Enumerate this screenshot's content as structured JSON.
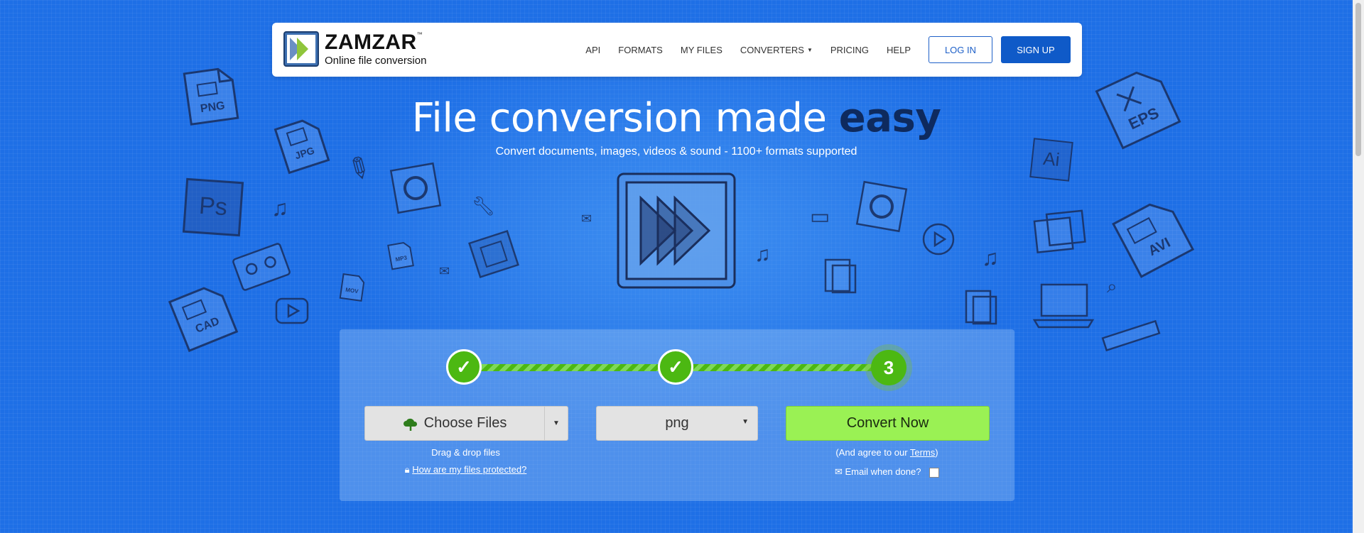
{
  "logo": {
    "name": "ZAMZAR",
    "trademark": "™",
    "tagline": "Online file conversion"
  },
  "nav": {
    "links": [
      "API",
      "FORMATS",
      "MY FILES",
      "CONVERTERS",
      "PRICING",
      "HELP"
    ],
    "login_label": "LOG IN",
    "signup_label": "SIGN UP"
  },
  "hero": {
    "title_start": "File conversion made ",
    "title_emphasis": "easy",
    "subtitle": "Convert documents, images, videos & sound - 1100+ formats supported"
  },
  "doodle_labels": {
    "png": "PNG",
    "jpg": "JPG",
    "ps": "Ps",
    "cad": "CAD",
    "eps": "EPS",
    "ai": "Ai",
    "avi": "AVI",
    "mp3": "MP3",
    "mov": "MOV"
  },
  "converter": {
    "steps": [
      {
        "label": "✓",
        "state": "complete"
      },
      {
        "label": "✓",
        "state": "complete"
      },
      {
        "label": "3",
        "state": "current"
      }
    ],
    "choose_label": "Choose Files",
    "format_value": "png",
    "convert_label": "Convert Now",
    "drag_hint": "Drag & drop files",
    "protected_link": "How are my files protected?",
    "agree_prefix": "(And agree to our ",
    "terms_link": "Terms",
    "agree_suffix": ")",
    "email_label": "Email when done?",
    "email_checked": false
  },
  "colors": {
    "background": "#1e6fe6",
    "brand_blue": "#0f5ac8",
    "step_green": "#4cb812",
    "convert_green": "#9af154",
    "title_dark": "#0e2a5e"
  }
}
